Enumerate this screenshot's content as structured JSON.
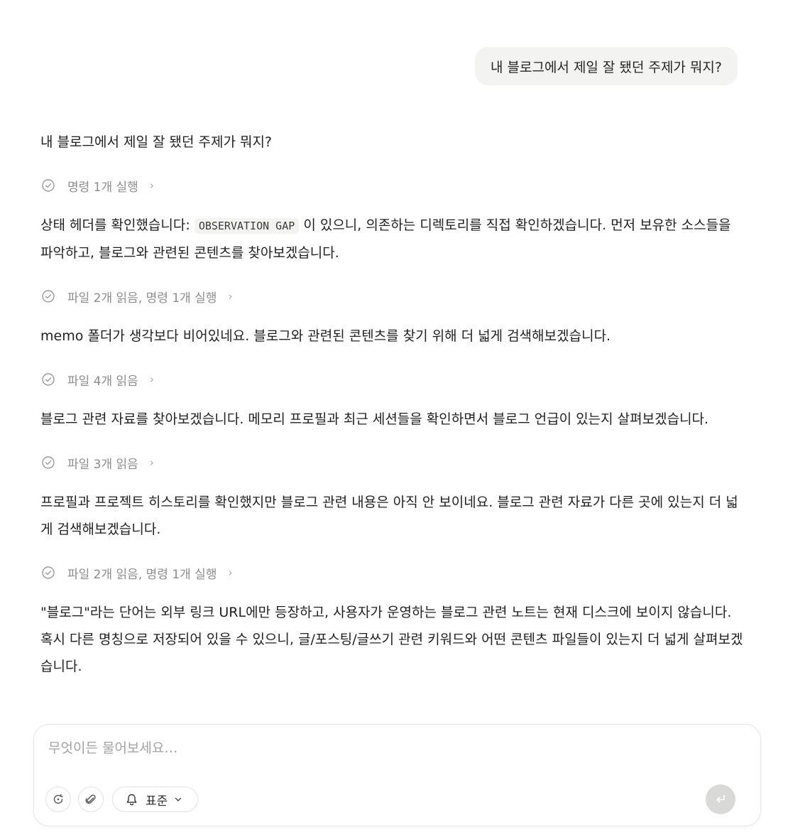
{
  "user_message": "내 블로그에서 제일 잘 됐던 주제가 뭐지?",
  "thread": {
    "echo": "내 블로그에서 제일 잘 됐던 주제가 뭐지?",
    "steps": [
      "명령 1개 실행",
      "파일 2개 읽음, 명령 1개 실행",
      "파일 4개 읽음",
      "파일 3개 읽음",
      "파일 2개 읽음, 명령 1개 실행"
    ],
    "p1_before": "상태 헤더를 확인했습니다: ",
    "p1_code": "OBSERVATION GAP",
    "p1_after": " 이 있으니, 의존하는 디렉토리를 직접 확인하겠습니다. 먼저 보유한 소스들을 파악하고, 블로그와 관련된 콘텐츠를 찾아보겠습니다.",
    "p2": "memo 폴더가 생각보다 비어있네요. 블로그와 관련된 콘텐츠를 찾기 위해 더 넓게 검색해보겠습니다.",
    "p3": "블로그 관련 자료를 찾아보겠습니다. 메모리 프로필과 최근 세션들을 확인하면서 블로그 언급이 있는지 살펴보겠습니다.",
    "p4": "프로필과 프로젝트 히스토리를 확인했지만 블로그 관련 내용은 아직 안 보이네요. 블로그 관련 자료가 다른 곳에 있는지 더 넓게 검색해보겠습니다.",
    "p5": "\"블로그\"라는 단어는 외부 링크 URL에만 등장하고, 사용자가 운영하는 블로그 관련 노트는 현재 디스크에 보이지 않습니다. 혹시 다른 명칭으로 저장되어 있을 수 있으니, 글/포스팅/글쓰기 관련 키워드와 어떤 콘텐츠 파일들이 있는지 더 넓게 살펴보겠습니다."
  },
  "composer": {
    "placeholder": "무엇이든 물어보세요…",
    "value": "",
    "mode_label": "표준",
    "icons": {
      "history": "history-icon",
      "attach": "paperclip-icon",
      "mode": "bell-icon",
      "send": "enter-icon"
    }
  },
  "colors": {
    "bubble_bg": "#f3f3f2",
    "muted_text": "#8c8c8c",
    "send_button": "#d9d9d7"
  }
}
